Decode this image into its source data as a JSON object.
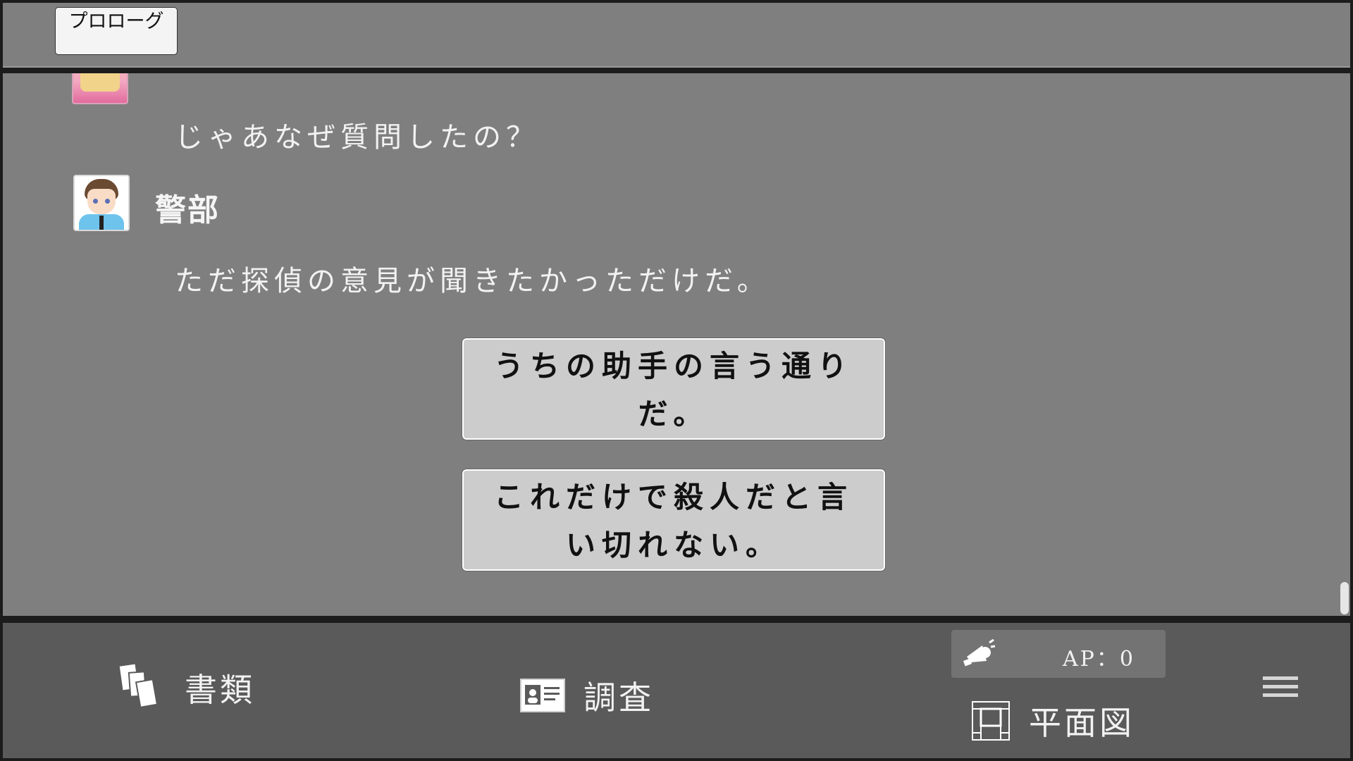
{
  "header": {
    "chapter_label": "プロローグ"
  },
  "log": {
    "entries": [
      {
        "speaker": "",
        "avatar": "assistant-portrait",
        "text": "じゃあなぜ質問したの？"
      },
      {
        "speaker": "警部",
        "avatar": "inspector-portrait",
        "text": "ただ探偵の意見が聞きたかっただけだ。"
      }
    ],
    "choices": [
      {
        "label": "うちの助手の言う通りだ。"
      },
      {
        "label": "これだけで殺人だと言い切れない。"
      }
    ]
  },
  "toolbar": {
    "documents_label": "書類",
    "documents_icon": "documents-icon",
    "investigate_label": "調査",
    "investigate_icon": "id-card-icon",
    "ap_label": "AP：0",
    "ap_icon": "megaphone-icon",
    "floorplan_label": "平面図",
    "floorplan_icon": "floorplan-icon",
    "menu_icon": "hamburger-menu-icon"
  }
}
